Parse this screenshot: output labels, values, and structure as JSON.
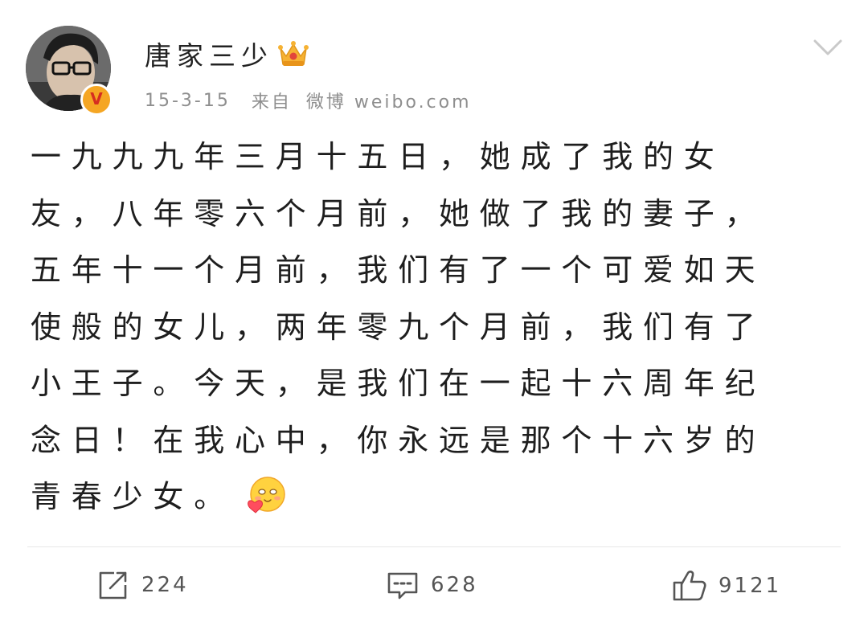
{
  "post": {
    "author": "唐家三少",
    "date": "15-3-15",
    "source_prefix": "来自",
    "source": "微博 weibo.com",
    "body_lines": [
      "一九九九年三月十五日，她成了我的女",
      "友，八年零六个月前，她做了我的妻子，",
      "五年十一个月前，我们有了一个可爱如天",
      "使般的女儿，两年零九个月前，我们有了",
      "小王子。今天，是我们在一起十六周年纪",
      "念日！在我心中，你永远是那个十六岁的",
      "青春少女。"
    ],
    "icons": {
      "avatar": "user-avatar",
      "verified": "verified-v-badge",
      "crown": "vip-crown-icon",
      "more": "chevron-down-icon",
      "emoji": "love-emoji-icon",
      "repost": "repost-icon",
      "comment": "comment-icon",
      "like": "thumbs-up-icon"
    },
    "badge_letter": "V"
  },
  "actions": {
    "repost_count": "224",
    "comment_count": "628",
    "like_count": "9121"
  },
  "colors": {
    "text": "#1e1e1e",
    "meta": "#8e8e8e",
    "badge": "#f5a623",
    "crown": "#f6b233",
    "icon": "#555555"
  }
}
